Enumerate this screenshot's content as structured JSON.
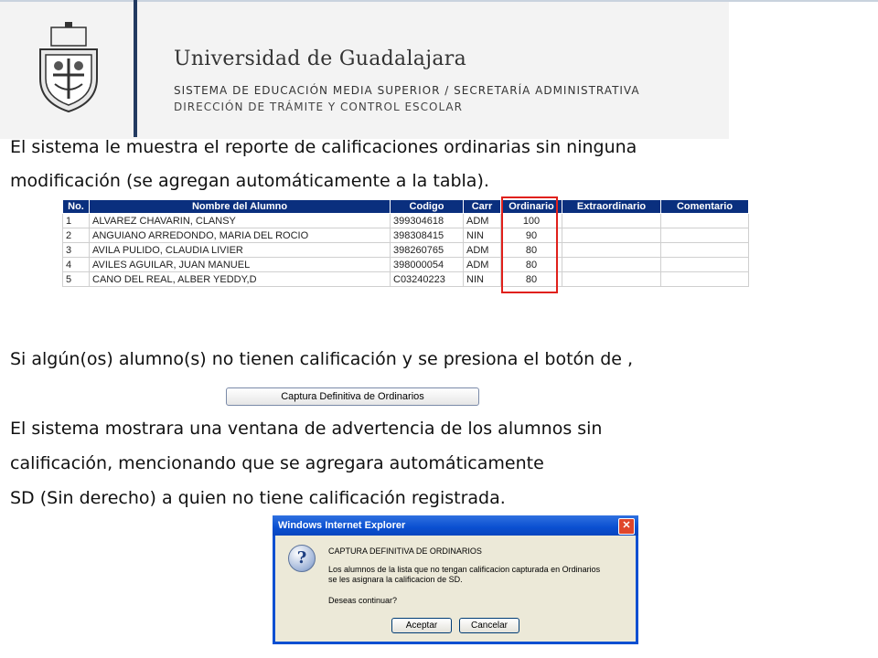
{
  "header": {
    "university": "Universidad de Guadalajara",
    "line1": "SISTEMA DE EDUCACIÓN MEDIA SUPERIOR / SECRETARÍA ADMINISTRATIVA",
    "line2": "DIRECCIÓN DE TRÁMITE Y CONTROL ESCOLAR",
    "accent": "#223a60"
  },
  "paragraphs": {
    "p1_line1": "El sistema le muestra el reporte de calificaciones ordinarias sin ninguna",
    "p1_line2": "modificación (se agregan automáticamente a la tabla).",
    "p2": "Si algún(os) alumno(s) no tienen calificación y se presiona el botón de ,",
    "p3_line1": "El sistema mostrara una ventana de advertencia de los alumnos sin",
    "p3_line2": "calificación, mencionando que se agregara automáticamente",
    "p3_line3": "SD (Sin derecho) a quien no tiene calificación registrada."
  },
  "table": {
    "headers": [
      "No.",
      "Nombre del Alumno",
      "Codigo",
      "Carr",
      "Ordinario",
      "Extraordinario",
      "Comentario"
    ],
    "rows": [
      [
        "1",
        "ALVAREZ CHAVARIN, CLANSY",
        "399304618",
        "ADM",
        "100",
        "",
        ""
      ],
      [
        "2",
        "ANGUIANO ARREDONDO, MARIA DEL ROCIO",
        "398308415",
        "NIN",
        "90",
        "",
        ""
      ],
      [
        "3",
        "AVILA PULIDO, CLAUDIA LIVIER",
        "398260765",
        "ADM",
        "80",
        "",
        ""
      ],
      [
        "4",
        "AVILES AGUILAR, JUAN MANUEL",
        "398000054",
        "ADM",
        "80",
        "",
        ""
      ],
      [
        "5",
        "CANO DEL REAL, ALBER YEDDY,D",
        "C03240223",
        "NIN",
        "80",
        "",
        ""
      ]
    ],
    "header_color": "#0a2f7e",
    "highlight_color": "#e0201b"
  },
  "capture_button": {
    "label": "Captura Definitiva de Ordinarios"
  },
  "dialog": {
    "title": "Windows Internet Explorer",
    "close_icon": "close-icon",
    "heading": "CAPTURA DEFINITIVA DE ORDINARIOS",
    "msg_line1": "Los alumnos de la lista que no tengan calificacion capturada en Ordinarios",
    "msg_line2": "se les asignara la calificacion de SD.",
    "question": "Deseas continuar?",
    "accept": "Aceptar",
    "cancel": "Cancelar"
  }
}
